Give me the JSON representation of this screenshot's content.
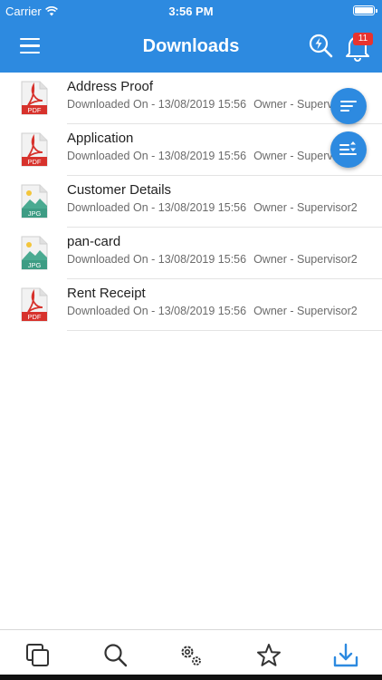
{
  "status_bar": {
    "carrier": "Carrier",
    "time": "3:56 PM"
  },
  "header": {
    "title": "Downloads",
    "notification_count": "11",
    "accent_color": "#2d8ae0",
    "badge_color": "#e8332f"
  },
  "files": [
    {
      "name": "Address Proof",
      "type": "PDF",
      "downloaded": "Downloaded On - 13/08/2019 15:56",
      "owner": "Owner - Supervisor2"
    },
    {
      "name": "Application",
      "type": "PDF",
      "downloaded": "Downloaded On - 13/08/2019 15:56",
      "owner": "Owner - Supervisor2"
    },
    {
      "name": "Customer Details",
      "type": "JPG",
      "downloaded": "Downloaded On - 13/08/2019 15:56",
      "owner": "Owner - Supervisor2"
    },
    {
      "name": "pan-card",
      "type": "JPG",
      "downloaded": "Downloaded On - 13/08/2019 15:56",
      "owner": "Owner - Supervisor2"
    },
    {
      "name": "Rent Receipt",
      "type": "PDF",
      "downloaded": "Downloaded On - 13/08/2019 15:56",
      "owner": "Owner - Supervisor2"
    }
  ],
  "tabs": [
    {
      "icon": "documents-icon",
      "active": false
    },
    {
      "icon": "search-icon",
      "active": false
    },
    {
      "icon": "settings-icon",
      "active": false
    },
    {
      "icon": "star-icon",
      "active": false
    },
    {
      "icon": "download-icon",
      "active": true
    }
  ]
}
